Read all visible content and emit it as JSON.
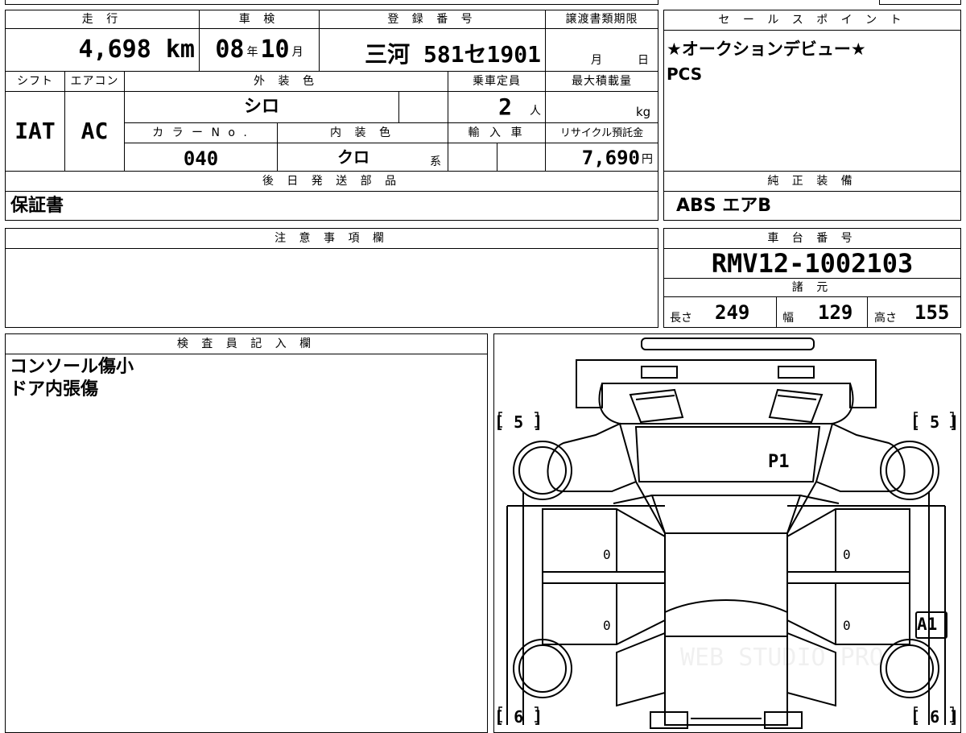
{
  "vehicle": {
    "mileage": {
      "label": "走 行",
      "value": "4,698",
      "unit": "km"
    },
    "inspection": {
      "label": "車 検",
      "year": "08",
      "year_unit": "年",
      "month": "10",
      "month_unit": "月"
    },
    "registration": {
      "label": "登 録 番 号",
      "value": "三河 581セ1901"
    },
    "transfer_deadline": {
      "label": "譲渡書類期限",
      "month_unit": "月",
      "day_unit": "日"
    },
    "shift": {
      "label": "シフト",
      "value": "IAT"
    },
    "aircon": {
      "label": "エアコン",
      "value": "AC"
    },
    "exterior_color": {
      "label": "外 装 色",
      "value": "シロ"
    },
    "capacity": {
      "label": "乗車定員",
      "value": "2",
      "unit": "人"
    },
    "max_load": {
      "label": "最大積載量",
      "unit": "kg"
    },
    "color_no": {
      "label": "カ ラ ー N o .",
      "value": "040"
    },
    "interior_color": {
      "label": "内 装 色",
      "value": "クロ",
      "unit": "系"
    },
    "imported": {
      "label": "輸 入 車"
    },
    "recycle_fee": {
      "label": "リサイクル預託金",
      "value": "7,690",
      "unit": "円"
    }
  },
  "sales_points": {
    "label": "セ ー ル ス ポ イ ン ト",
    "lines": [
      "★オークションデビュー★",
      "PCS"
    ]
  },
  "later_parts": {
    "label": "後 日 発 送 部 品",
    "value": "保証書"
  },
  "genuine_equipment": {
    "label": "純 正 装 備",
    "value": "ABS エアB"
  },
  "notes": {
    "label": "注 意 事 項 欄"
  },
  "chassis": {
    "label": "車 台 番 号",
    "value": "RMV12-1002103"
  },
  "specs": {
    "label": "諸 元",
    "length": {
      "label": "長さ",
      "value": "249"
    },
    "width": {
      "label": "幅",
      "value": "129"
    },
    "height": {
      "label": "高さ",
      "value": "155"
    }
  },
  "inspector": {
    "label": "検 査 員 記 入 欄",
    "lines": [
      "コンソール傷小",
      "ドア内張傷"
    ]
  },
  "diagram": {
    "tire_front_left": "[ 5 ]",
    "tire_front_right": "[ 5 ]",
    "tire_rear_left": "[ 6 ]",
    "tire_rear_right": "[ 6 ]",
    "mark_hood": "P1",
    "mark_right_rear": "A1",
    "door_fl": "0",
    "door_fr": "0",
    "door_rl": "0",
    "door_rr": "0",
    "watermark": "WEB STUDIO PRO"
  }
}
